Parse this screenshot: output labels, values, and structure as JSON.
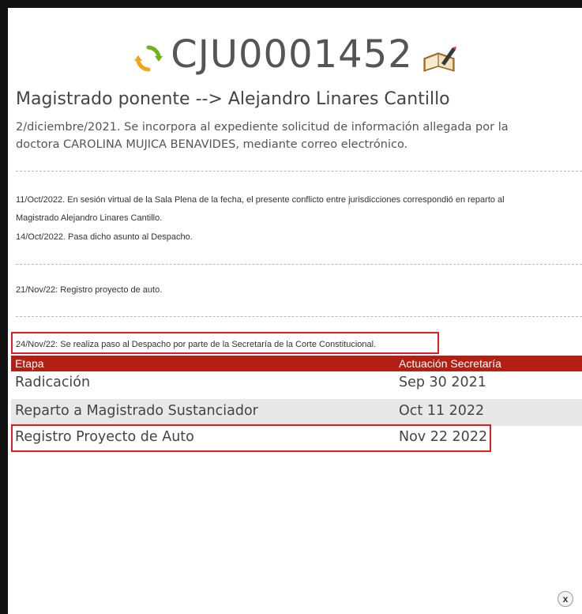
{
  "header": {
    "case_id": "CJU0001452",
    "refresh_icon": "refresh-icon",
    "book_icon": "book-edit-icon"
  },
  "magistrate": "Magistrado ponente --> Alejandro Linares Cantillo",
  "main_note": "2/diciembre/2021. Se incorpora al expediente solicitud de información allegada por la doctora CAROLINA MUJICA BENAVIDES, mediante correo electrónico.",
  "notes": {
    "n1_line1": "11/Oct/2022. En sesión virtual de la Sala Plena de la fecha, el presente conflicto entre jurisdicciones correspondió en reparto al",
    "n1_line2": "Magistrado Alejandro Linares Cantillo.",
    "n1_line3": "14/Oct/2022. Pasa dicho asunto al Despacho.",
    "n2": "21/Nov/22: Registro proyecto de auto.",
    "n3": "24/Nov/22: Se realiza paso al Despacho por parte de la Secretaría de la Corte Constitucional."
  },
  "table": {
    "headers": [
      "Etapa",
      "Actuación Secretaría"
    ],
    "rows": [
      [
        "Radicación",
        "Sep 30 2021"
      ],
      [
        "Reparto a Magistrado Sustanciador",
        "Oct 11 2022"
      ],
      [
        "Registro Proyecto de Auto",
        "Nov 22 2022"
      ]
    ]
  },
  "close": {
    "label": "x",
    "icon": "close-icon"
  },
  "colors": {
    "table_header": "#b41f14",
    "highlight": "#e11d1d",
    "alt_row": "#e8e8e8"
  }
}
